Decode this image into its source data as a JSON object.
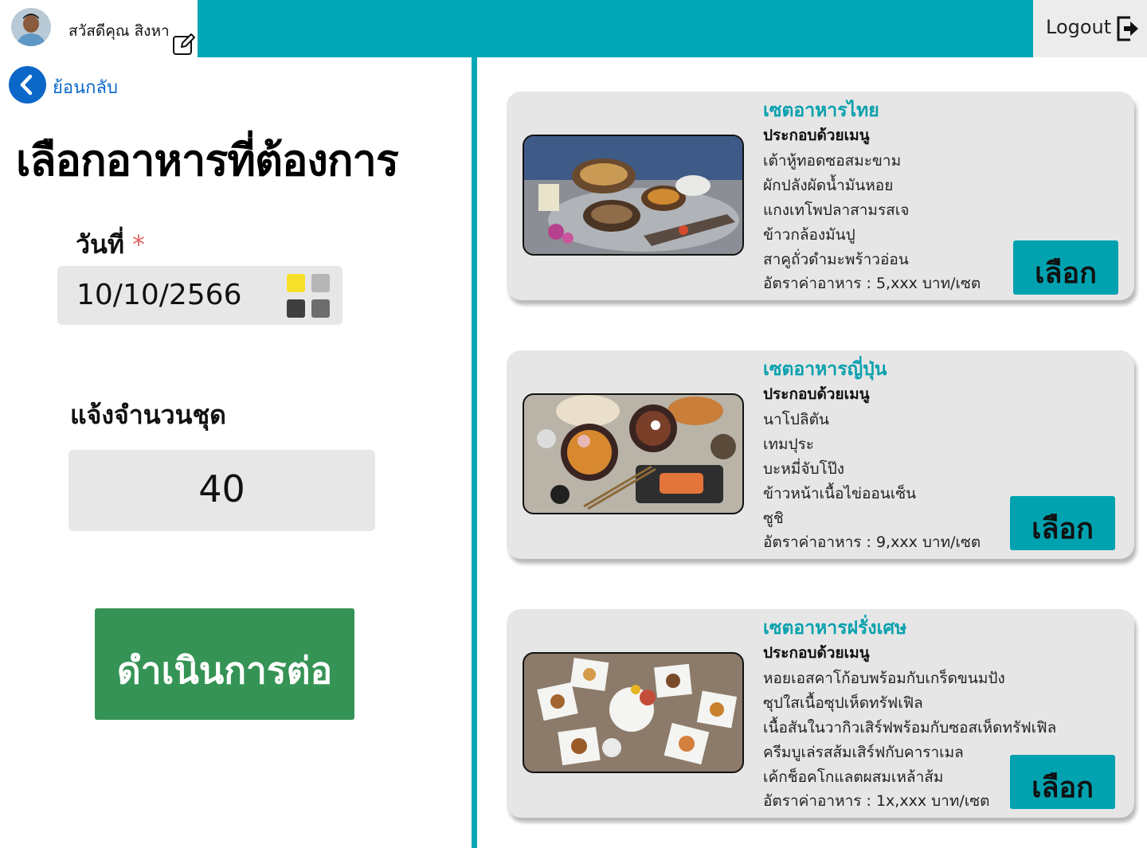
{
  "header": {
    "greeting": "สวัสดีคุณ สิงหา",
    "logout_label": "Logout",
    "accent_color": "#00a8b5"
  },
  "nav": {
    "back_label": "ย้อนกลับ"
  },
  "page": {
    "title": "เลือกอาหารที่ต้องการ"
  },
  "form": {
    "date_label": "วันที่",
    "required_mark": "*",
    "date_value": "10/10/2566",
    "quantity_label": "แจ้งจำนวนชุด",
    "quantity_value": "40",
    "proceed_label": "ดำเนินการต่อ",
    "proceed_color": "#359455"
  },
  "food_sets": [
    {
      "title": "เซตอาหารไทย",
      "subtitle": "ประกอบด้วยเมนู",
      "items": [
        "เต้าหู้ทอดซอสมะขาม",
        "ผักปลังผัดน้ำมันหอย",
        "แกงเทโพปลาสามรสเจ",
        "ข้าวกล้องมันปู",
        "สาคูถั่วดำมะพร้าวอ่อน"
      ],
      "price": "อัตราค่าอาหาร : 5,xxx บาท/เซต",
      "select_label": "เลือก"
    },
    {
      "title": "เซตอาหารญี่ปุ่น",
      "subtitle": "ประกอบด้วยเมนู",
      "items": [
        "นาโปลิตัน",
        "เทมปุระ",
        "บะหมี่จับโป๊ง",
        "ข้าวหน้าเนื้อไข่ออนเซ็น",
        "ซูชิ"
      ],
      "price": "อัตราค่าอาหาร : 9,xxx บาท/เซต",
      "select_label": "เลือก"
    },
    {
      "title": "เซตอาหารฝรั่งเศษ",
      "subtitle": "ประกอบด้วยเมนู",
      "items": [
        "หอยเอสคาโก้อบพร้อมกับเกร็ดขนมปัง",
        "ซุปใสเนื้อซุปเห็ดทรัฟเฟิล",
        "เนื้อสันในวากิวเสิร์ฟพร้อมกับซอสเห็ดทรัฟเฟิล",
        "ครีมบูเล่รสส้มเสิร์ฟกับคาราเมล",
        "เค้กช็อคโกแลตผสมเหล้าส้ม"
      ],
      "price": "อัตราค่าอาหาร : 1x,xxx บาท/เซต",
      "select_label": "เลือก"
    }
  ]
}
